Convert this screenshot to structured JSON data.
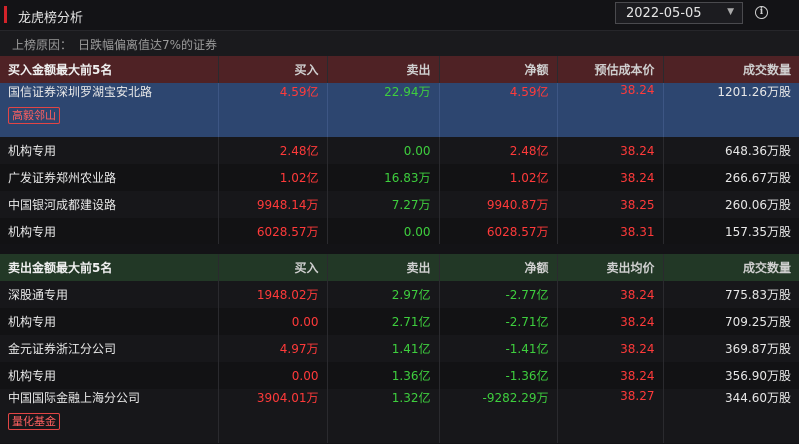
{
  "header": {
    "title": "龙虎榜分析",
    "date": "2022-05-05",
    "info_icon": "info-icon"
  },
  "reason": {
    "label": "上榜原因：",
    "value": "日跌幅偏离值达7%的证券"
  },
  "buy_section": {
    "title": "买入金额最大前5名",
    "columns": [
      "买入",
      "卖出",
      "净额",
      "预估成本价",
      "成交数量"
    ],
    "rows": [
      {
        "name": "国信证券深圳罗湖宝安北路",
        "buy": "4.59亿",
        "sell": "22.94万",
        "net": "4.59亿",
        "price": "38.24",
        "volume": "1201.26万股",
        "tag": "高毅邻山"
      },
      {
        "name": "机构专用",
        "buy": "2.48亿",
        "sell": "0.00",
        "net": "2.48亿",
        "price": "38.24",
        "volume": "648.36万股"
      },
      {
        "name": "广发证券郑州农业路",
        "buy": "1.02亿",
        "sell": "16.83万",
        "net": "1.02亿",
        "price": "38.24",
        "volume": "266.67万股"
      },
      {
        "name": "中国银河成都建设路",
        "buy": "9948.14万",
        "sell": "7.27万",
        "net": "9940.87万",
        "price": "38.25",
        "volume": "260.06万股"
      },
      {
        "name": "机构专用",
        "buy": "6028.57万",
        "sell": "0.00",
        "net": "6028.57万",
        "price": "38.31",
        "volume": "157.35万股"
      }
    ]
  },
  "sell_section": {
    "title": "卖出金额最大前5名",
    "columns": [
      "买入",
      "卖出",
      "净额",
      "卖出均价",
      "成交数量"
    ],
    "rows": [
      {
        "name": "深股通专用",
        "buy": "1948.02万",
        "sell": "2.97亿",
        "net": "-2.77亿",
        "price": "38.24",
        "volume": "775.83万股"
      },
      {
        "name": "机构专用",
        "buy": "0.00",
        "sell": "2.71亿",
        "net": "-2.71亿",
        "price": "38.24",
        "volume": "709.25万股"
      },
      {
        "name": "金元证券浙江分公司",
        "buy": "4.97万",
        "sell": "1.41亿",
        "net": "-1.41亿",
        "price": "38.24",
        "volume": "369.87万股"
      },
      {
        "name": "机构专用",
        "buy": "0.00",
        "sell": "1.36亿",
        "net": "-1.36亿",
        "price": "38.24",
        "volume": "356.90万股"
      },
      {
        "name": "中国国际金融上海分公司",
        "buy": "3904.01万",
        "sell": "1.32亿",
        "net": "-9282.29万",
        "price": "38.27",
        "volume": "344.60万股",
        "tag": "量化基金"
      }
    ]
  },
  "colors": {
    "up": "#ff3a3a",
    "down": "#3ecf3e",
    "selected_row": "#2d4670",
    "buy_header": "#4f2225",
    "sell_header": "#223826"
  }
}
